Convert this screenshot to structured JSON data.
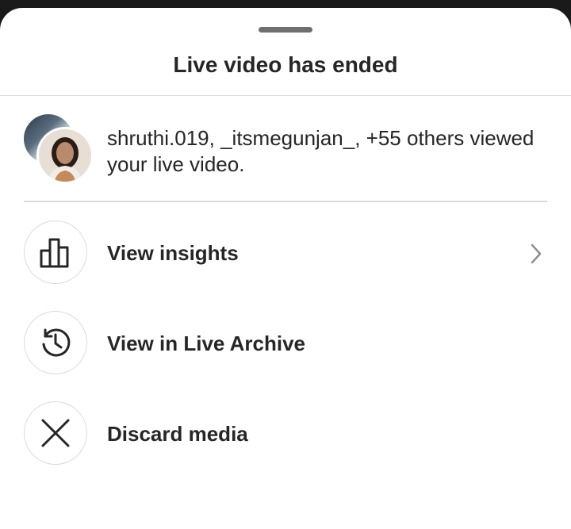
{
  "sheet": {
    "title": "Live video has ended"
  },
  "viewers": {
    "text": "shruthi.019, _itsmegunjan_, +55 others viewed your live video."
  },
  "options": [
    {
      "label": "View insights",
      "icon": "bar-chart-icon",
      "has_chevron": true
    },
    {
      "label": "View in Live Archive",
      "icon": "history-icon",
      "has_chevron": false
    },
    {
      "label": "Discard media",
      "icon": "close-icon",
      "has_chevron": false
    }
  ],
  "colors": {
    "text": "#262626",
    "divider": "#dbdbdb",
    "handle": "#6f6f6f",
    "chevron": "#8e8e8e"
  }
}
